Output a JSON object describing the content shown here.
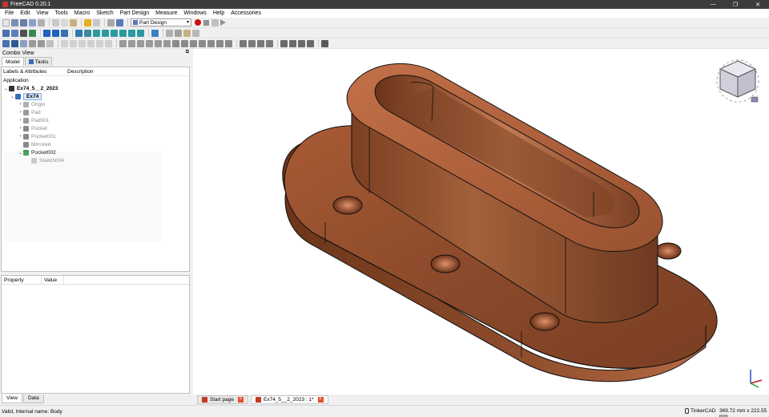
{
  "window": {
    "title": "FreeCAD 0.20.1",
    "controls": [
      "—",
      "❐",
      "✕"
    ]
  },
  "menu": [
    "File",
    "Edit",
    "View",
    "Tools",
    "Macro",
    "Sketch",
    "Part Design",
    "Measure",
    "Windows",
    "Help",
    "Accessories"
  ],
  "toolbar": {
    "workbench": "Part Design"
  },
  "combo_view": {
    "title": "Combo View",
    "tabs": [
      "Model",
      "Tasks"
    ],
    "columns": [
      "Labels & Attributes",
      "Description"
    ],
    "root": "Application",
    "document": "Ex74_5__2_2023",
    "body": "Ex74",
    "features": [
      "Origin",
      "Pad",
      "Pad001",
      "Pocket",
      "Pocket001",
      "Mirrored",
      "Pocket002"
    ],
    "child_sketch": "Sketch004"
  },
  "properties": {
    "columns": [
      "Property",
      "Value"
    ],
    "tabs": [
      "View",
      "Data"
    ]
  },
  "document_tabs": [
    "Start page",
    "Ex74_5__2_2023 : 1*"
  ],
  "status": {
    "message": "Valid, Internal name: Body",
    "navigation": "TinkerCAD",
    "dimensions": "369.72 mm x 222.55 mm"
  },
  "colors": {
    "model": "#8b4a2b",
    "model_light": "#c77650",
    "model_dark": "#5e2e18",
    "titlebar": "#3c3c3c"
  }
}
